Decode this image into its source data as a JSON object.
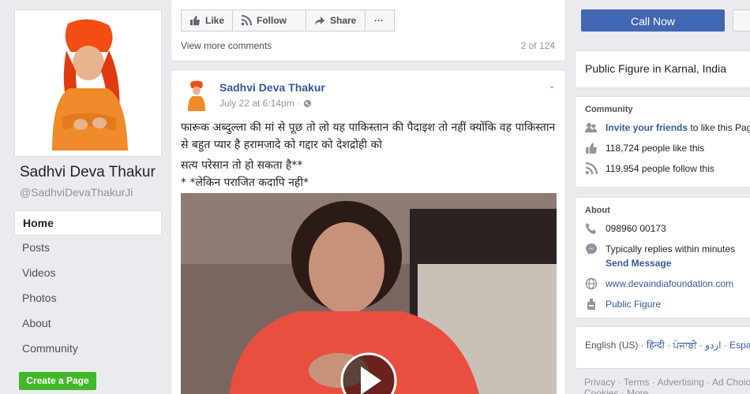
{
  "sidebar": {
    "page_name": "Sadhvi Deva Thakur",
    "handle": "@SadhviDevaThakurJi",
    "nav": [
      {
        "label": "Home"
      },
      {
        "label": "Posts"
      },
      {
        "label": "Videos"
      },
      {
        "label": "Photos"
      },
      {
        "label": "About"
      },
      {
        "label": "Community"
      }
    ],
    "create_page": "Create a Page"
  },
  "actions": {
    "like": "Like",
    "follow": "Follow",
    "share": "Share",
    "more": "···",
    "view_more": "View more comments",
    "count": "2 of 124"
  },
  "post": {
    "author": "Sadhvi Deva Thakur",
    "time": "July 22 at 6:14pm ·",
    "text_line1": "फारूक अब्दुल्ला की मां से पूछ तो लो यह पाकिस्तान की पैदाइश तो नहीं क्योंकि वह पाकिस्तान से बहुत प्यार है हरामजादे को गद्दार को देशद्रोही को",
    "text_line2": "सत्य परेसान तो हो सकता है**",
    "text_line3": "* *लेकिन पराजित कदापि नही*"
  },
  "right": {
    "call_now": "Call Now",
    "category": "Public Figure in Karnal, India",
    "community": {
      "heading": "Community",
      "invite_link": "Invite your friends",
      "invite_rest": " to like this Page",
      "likes": "118,724 people like this",
      "follows": "119,954 people follow this"
    },
    "about": {
      "heading": "About",
      "phone": "098960 00173",
      "replies": "Typically replies within minutes",
      "send_message": "Send Message",
      "website": "www.devaindiafoundation.com",
      "category": "Public Figure"
    },
    "languages": {
      "current": "English (US)",
      "others": "हिन्दी · ਪੰਜਾਬੀ · اردو · Español"
    },
    "footer_line1": "Privacy · Terms · Advertising · Ad Choices",
    "footer_line2": "Cookies · More"
  }
}
